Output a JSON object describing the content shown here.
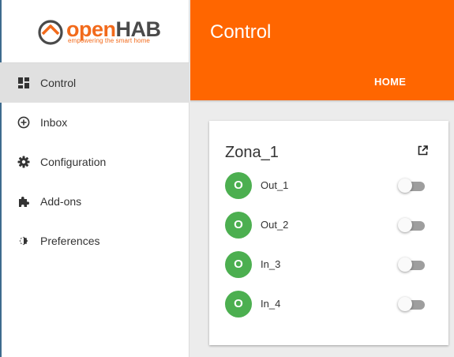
{
  "logo": {
    "name_part1": "open",
    "name_part2": "HAB",
    "tagline": "empowering the smart home"
  },
  "sidebar": {
    "items": [
      {
        "label": "Control",
        "icon": "dashboard-icon",
        "active": true
      },
      {
        "label": "Inbox",
        "icon": "add-circle-icon",
        "active": false
      },
      {
        "label": "Configuration",
        "icon": "gear-icon",
        "active": false
      },
      {
        "label": "Add-ons",
        "icon": "puzzle-icon",
        "active": false
      },
      {
        "label": "Preferences",
        "icon": "brightness-icon",
        "active": false
      }
    ]
  },
  "header": {
    "title": "Control",
    "tab": "HOME",
    "color": "#ff6600"
  },
  "card": {
    "title": "Zona_1",
    "items": [
      {
        "label": "Out_1",
        "badge": "O",
        "state": false
      },
      {
        "label": "Out_2",
        "badge": "O",
        "state": false
      },
      {
        "label": "In_3",
        "badge": "O",
        "state": false
      },
      {
        "label": "In_4",
        "badge": "O",
        "state": false
      }
    ]
  },
  "colors": {
    "accent": "#ff6600",
    "badge": "#4caf50",
    "logo_orange": "#f26a1b"
  }
}
